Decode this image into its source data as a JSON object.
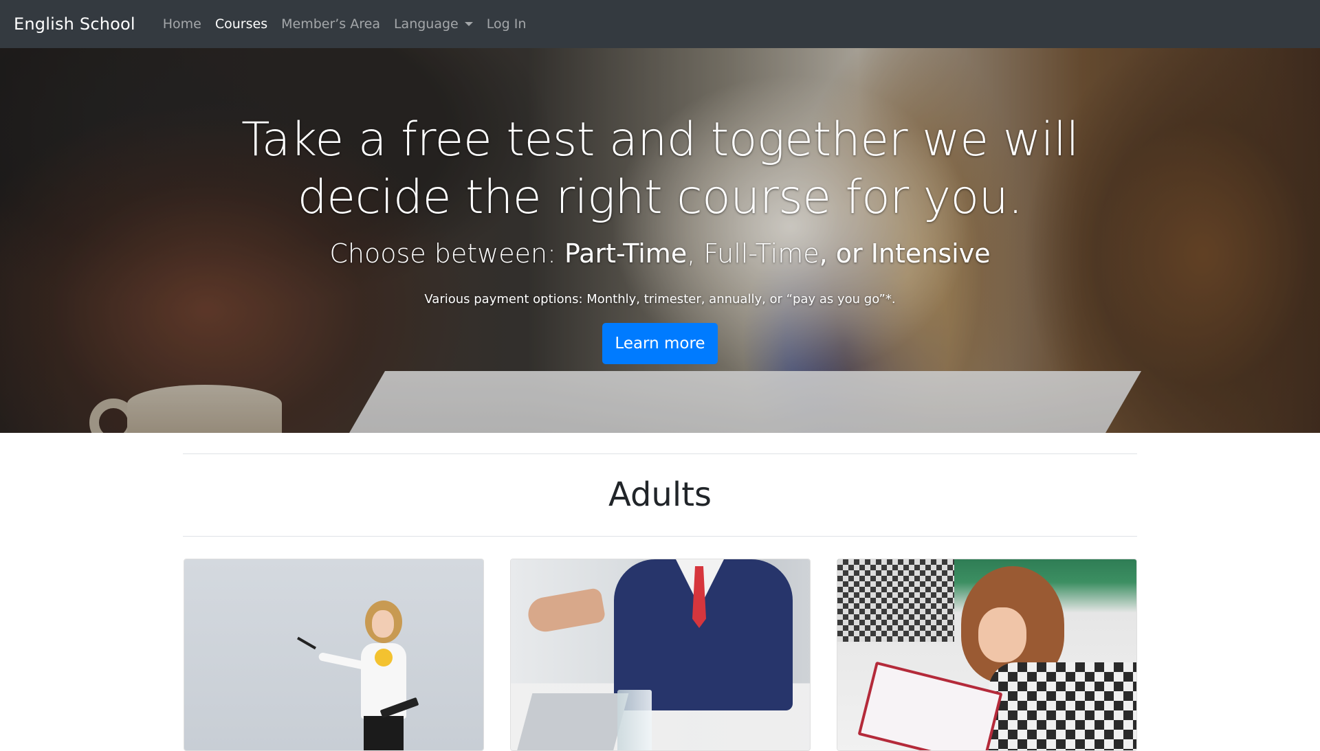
{
  "navbar": {
    "brand": "English School",
    "links": [
      {
        "label": "Home"
      },
      {
        "label": "Courses"
      },
      {
        "label": "Member’s Area"
      },
      {
        "label": "Language"
      },
      {
        "label": "Log In"
      }
    ]
  },
  "hero": {
    "title": "Take a free test and together we will decide the right course for you.",
    "subtitle_prefix": "Choose between: ",
    "subtitle_option1": "Part-Time",
    "subtitle_sep1": ", ",
    "subtitle_option2": "Full-Time",
    "subtitle_sep2": ", or ",
    "subtitle_option3": "Intensive",
    "payment_note": "Various payment options: Monthly, trimester, annually, or “pay as you go”*.",
    "cta_label": "Learn more"
  },
  "section": {
    "title": "Adults"
  },
  "colors": {
    "navbar_bg": "#343a40",
    "primary": "#007bff"
  }
}
